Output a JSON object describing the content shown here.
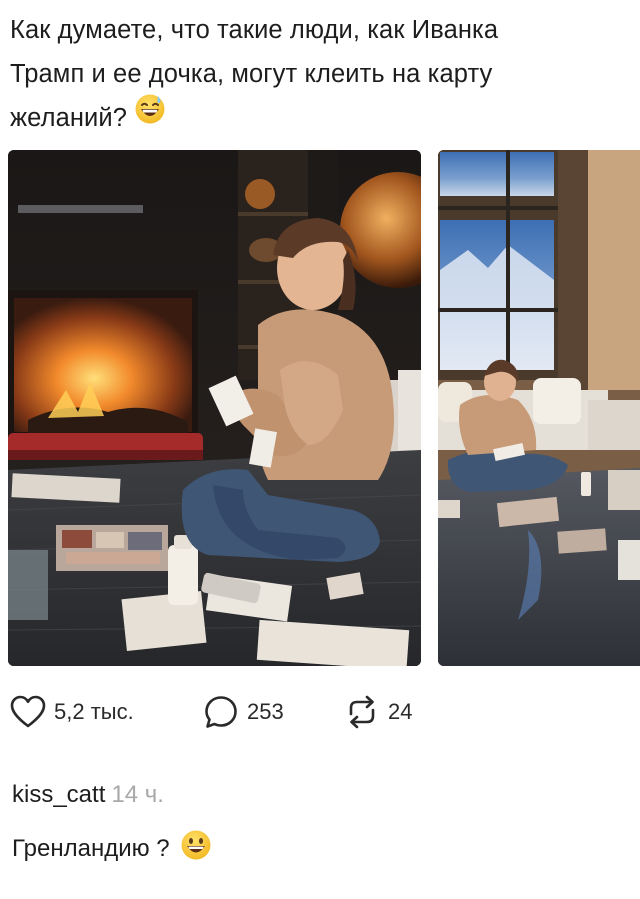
{
  "post": {
    "line1": "Как думаете, что такие люди, как Иванка",
    "line2": "Трамп и ее дочка, могут клеить на карту",
    "line3": "желаний?",
    "emoji": "grinning-sweat-emoji"
  },
  "photos": [
    {
      "name": "photo-girl-by-fireplace"
    },
    {
      "name": "photo-living-room-coffee-table"
    }
  ],
  "actions": {
    "likes": "5,2 тыс.",
    "replies": "253",
    "reposts": "24"
  },
  "comment": {
    "username": "kiss_catt",
    "time": "14 ч.",
    "text": "Гренландию ?",
    "emoji": "grinning-emoji"
  },
  "colors": {
    "text": "#1d1d1d",
    "muted": "#a8a8a8",
    "emoji_yellow": "#f6c531"
  }
}
